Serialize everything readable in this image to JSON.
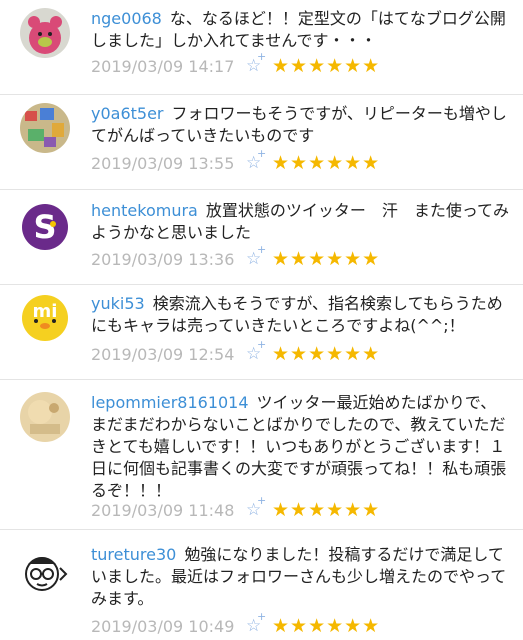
{
  "colors": {
    "username": "#3d8fd6",
    "timestamp": "#b8b8b8",
    "star_yellow": "#f5b800",
    "add_star_blue": "#8fb3e3"
  },
  "comments": [
    {
      "user": "nge0068",
      "text": "な、なるほど！！定型文の「はてなブログ公開しました」しか入れてませんです・・・",
      "timestamp": "2019/03/09 14:17",
      "stars": "★★★★★★",
      "avatar": "pink-bear-avatar"
    },
    {
      "user": "y0a6t5er",
      "text": "フォロワーもそうですが、リピーターも増やしてがんばっていきたいものです",
      "timestamp": "2019/03/09 13:55",
      "stars": "★★★★★★",
      "avatar": "colorful-pattern-avatar"
    },
    {
      "user": "hentekomura",
      "text": "放置状態のツイッター　汗　また使ってみようかなと思いました",
      "timestamp": "2019/03/09 13:36",
      "stars": "★★★★★★",
      "avatar": "purple-s-logo-avatar"
    },
    {
      "user": "yuki53",
      "text": "検索流入もそうですが、指名検索してもらうためにもキャラは売っていきたいところですよね(^^;！",
      "timestamp": "2019/03/09 12:54",
      "stars": "★★★★★★",
      "avatar": "yellow-chick-avatar"
    },
    {
      "user": "lepommier8161014",
      "text": "ツイッター最近始めたばかりで、まだまだわからないことばかりでしたので、教えていただきとても嬉しいです！！いつもありがとうございます！１日に何個も記事書くの大変ですが頑張ってね！！私も頑張るぞ！！！",
      "timestamp": "2019/03/09 11:48",
      "stars": "★★★★★★",
      "avatar": "beige-photo-avatar"
    },
    {
      "user": "tureture30",
      "text": "勉強になりました！投稿するだけで満足していました。最近はフォロワーさんも少し増えたのでやってみます。",
      "timestamp": "2019/03/09 10:49",
      "stars": "★★★★★★",
      "avatar": "glasses-face-avatar"
    }
  ]
}
